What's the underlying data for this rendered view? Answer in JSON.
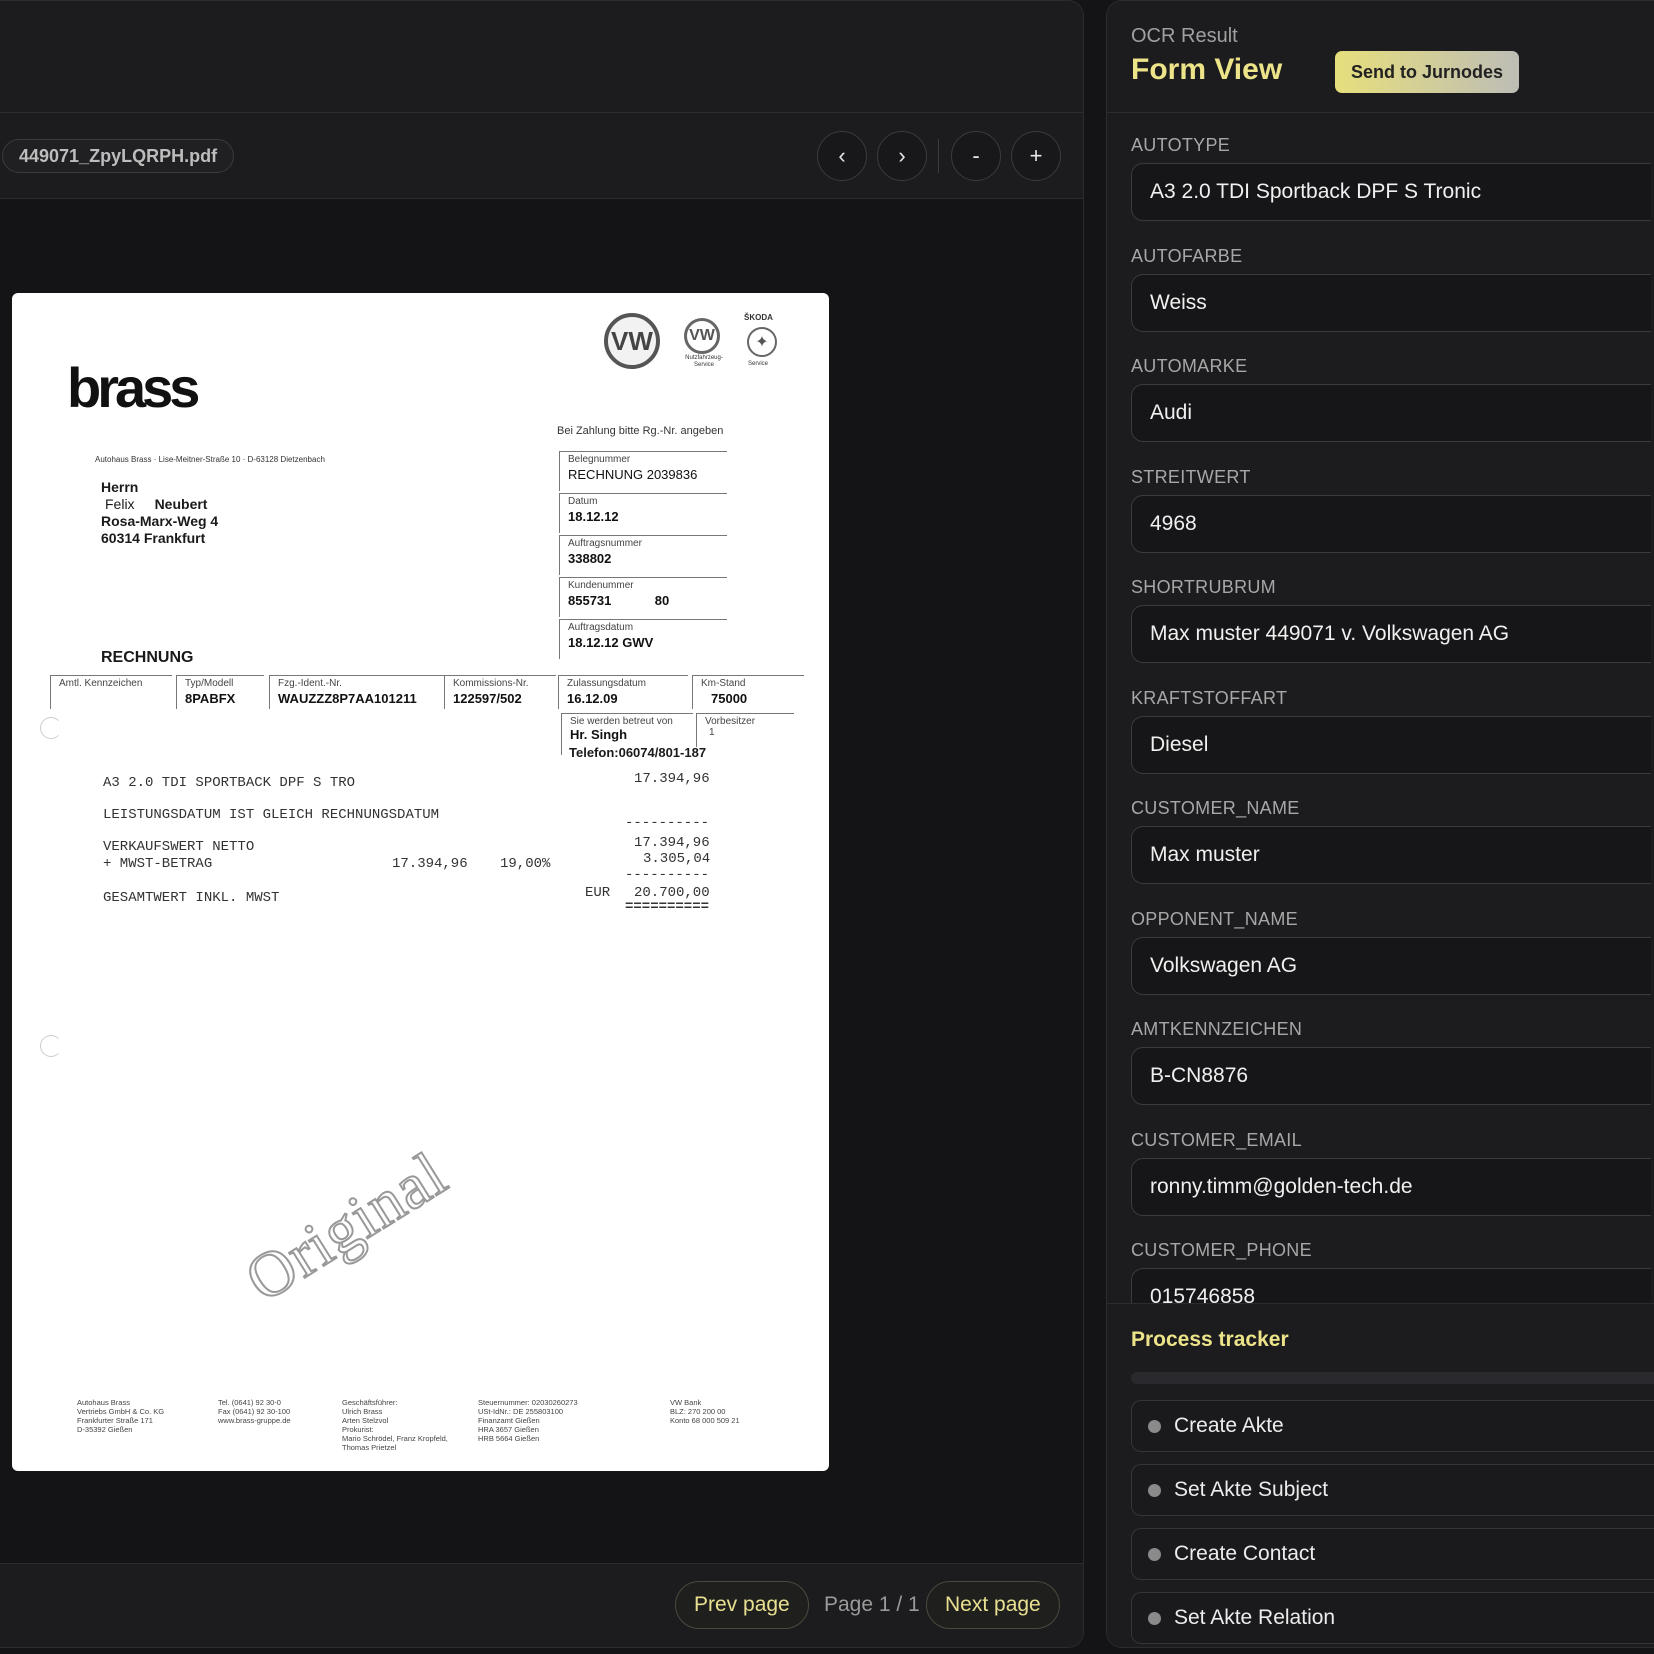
{
  "viewer": {
    "file_name": "449071_ZpyLQRPH.pdf",
    "toolbar": {
      "prev_icon": "‹",
      "next_icon": "›",
      "zoom_out": "-",
      "zoom_in": "+"
    },
    "footer": {
      "prev_label": "Prev page",
      "page_indicator": "Page 1 / 1",
      "next_label": "Next page"
    }
  },
  "document": {
    "logo": "brass",
    "vw_logo": "VW",
    "nutz_text": "Nutzfahrzeug-\nService",
    "skoda_text": "ŠKODA",
    "skoda_service": "Service",
    "payment_note": "Bei Zahlung bitte Rg.-Nr. angeben",
    "sender_line": "Autohaus Brass · Lise-Meitner-Straße 10 · D-63128 Dietzenbach",
    "recipient": {
      "salutation": "Herrn",
      "first": "Felix",
      "last": "Neubert",
      "street": "Rosa-Marx-Weg 4",
      "city": "60314 Frankfurt"
    },
    "info_boxes": [
      {
        "label": "Belegnummer",
        "value": "RECHNUNG   2039836"
      },
      {
        "label": "Datum",
        "value": "18.12.12"
      },
      {
        "label": "Auftragsnummer",
        "value": "338802"
      },
      {
        "label": "Kundenummer",
        "value": "855731            80"
      },
      {
        "label": "Auftragsdatum",
        "value": "18.12.12  GWV"
      }
    ],
    "title": "RECHNUNG",
    "vehicle_row": [
      {
        "label": "Amtl. Kennzeichen",
        "value": ""
      },
      {
        "label": "Typ/Modell",
        "value": "8PABFX"
      },
      {
        "label": "Fzg.-Ident.-Nr.",
        "value": "WAUZZZ8P7AA101211"
      },
      {
        "label": "Kommissions-Nr.",
        "value": "122597/502"
      },
      {
        "label": "Zulassungsdatum",
        "value": "16.12.09"
      },
      {
        "label": "Km-Stand",
        "value": "75000"
      }
    ],
    "advisor": {
      "label": "Sie werden betreut von",
      "name": "Hr. Singh",
      "phone": "Telefon:06074/801-187"
    },
    "prev_owner": {
      "label": "Vorbesitzer",
      "value": "1"
    },
    "lines": {
      "item": "A3 2.0 TDI SPORTBACK DPF S TRO",
      "item_amount": "17.394,96",
      "note": "LEISTUNGSDATUM IST GLEICH RECHNUNGSDATUM",
      "dash": "----------",
      "net_label": "VERKAUFSWERT NETTO",
      "net_amount": "17.394,96",
      "vat_label": "+ MWST-BETRAG",
      "vat_base": "17.394,96",
      "vat_rate": "19,00%",
      "vat_amount": "3.305,04",
      "total_label": "GESAMTWERT INKL. MWST",
      "currency": "EUR",
      "total_amount": "20.700,00",
      "double": "=========="
    },
    "stamp": "Original",
    "footer_cols": [
      "Autohaus Brass\nVertriebs GmbH & Co. KG\nFrankfurter Straße 171\nD-35392 Gießen",
      "Tel. (0641) 92 30-0\nFax (0641) 92 30-100\nwww.brass-gruppe.de",
      "Geschäftsführer:\nUlrich Brass\nArten Stelzvol\nProkurist:\nMario Schrödel, Franz Kropfeld,\nThomas Prietzel",
      "Steuernummer: 02030260273\nUSt-IdNr.: DE 255803100\nFinanzamt Gießen\nHRA 3657 Gießen\nHRB 5664 Gießen",
      "VW Bank\nBLZ: 270 200 00\nKonto 68 000 509 21"
    ]
  },
  "ocr": {
    "overline": "OCR Result",
    "title": "Form View",
    "send_label": "Send to Jurnodes",
    "fields": [
      {
        "label": "AUTOTYPE",
        "value": "A3 2.0 TDI Sportback DPF S Tronic"
      },
      {
        "label": "AUTOFARBE",
        "value": "Weiss"
      },
      {
        "label": "AUTOMARKE",
        "value": "Audi"
      },
      {
        "label": "STREITWERT",
        "value": "4968"
      },
      {
        "label": "SHORTRUBRUM",
        "value": "Max muster 449071 v. Volkswagen AG"
      },
      {
        "label": "KRAFTSTOFFART",
        "value": "Diesel"
      },
      {
        "label": "CUSTOMER_NAME",
        "value": "Max muster"
      },
      {
        "label": "OPPONENT_NAME",
        "value": "Volkswagen AG"
      },
      {
        "label": "AMTKENNZEICHEN",
        "value": "B-CN8876"
      },
      {
        "label": "CUSTOMER_EMAIL",
        "value": "ronny.timm@golden-tech.de"
      },
      {
        "label": "CUSTOMER_PHONE",
        "value": "015746858"
      }
    ],
    "tracker": {
      "title": "Process tracker",
      "steps": [
        "Create Akte",
        "Set Akte Subject",
        "Create Contact",
        "Set Akte Relation"
      ]
    }
  }
}
